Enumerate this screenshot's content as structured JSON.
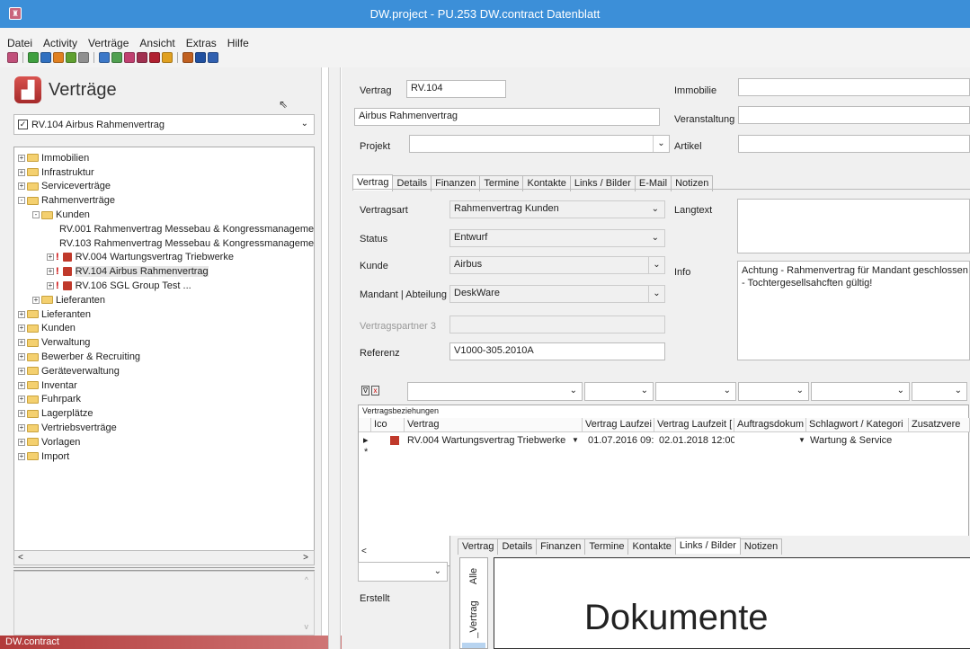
{
  "window": {
    "title": "DW.project - PU.253 DW.contract Datenblatt"
  },
  "menu": [
    "Datei",
    "Activity",
    "Verträge",
    "Ansicht",
    "Extras",
    "Hilfe"
  ],
  "toolbar_colors": [
    "#c0507a",
    "#40a040",
    "#3070c0",
    "#e08020",
    "#60a030",
    "#909090",
    "#3c78c8",
    "#50a050",
    "#c04070",
    "#a03050",
    "#b02030",
    "#e0a020",
    "#c06020",
    "#2050a0",
    "#3060b0"
  ],
  "left": {
    "title": "Verträge",
    "selector": {
      "checked": true,
      "value": "RV.104 Airbus Rahmenvertrag"
    },
    "tree": [
      {
        "label": "Immobilien",
        "level": 0,
        "type": "folder",
        "exp": "+"
      },
      {
        "label": "Infrastruktur",
        "level": 0,
        "type": "folder",
        "exp": "+"
      },
      {
        "label": "Serviceverträge",
        "level": 0,
        "type": "folder",
        "exp": "+"
      },
      {
        "label": "Rahmenverträge",
        "level": 0,
        "type": "folder",
        "exp": "-"
      },
      {
        "label": "Kunden",
        "level": 1,
        "type": "folder",
        "exp": "-"
      },
      {
        "label": "RV.001 Rahmenvertrag Messebau & Kongressmanageme",
        "level": 2,
        "type": "doc"
      },
      {
        "label": "RV.103 Rahmenvertrag Messebau & Kongressmanageme",
        "level": 2,
        "type": "doc"
      },
      {
        "label": "RV.004 Wartungsvertrag Triebwerke",
        "level": 2,
        "type": "doc",
        "exp": "+",
        "bang": true
      },
      {
        "label": "RV.104 Airbus Rahmenvertrag",
        "level": 2,
        "type": "doc",
        "exp": "+",
        "bang": true,
        "selected": true
      },
      {
        "label": "RV.106 SGL Group Test ...",
        "level": 2,
        "type": "doc",
        "exp": "+",
        "bang": true
      },
      {
        "label": "Lieferanten",
        "level": 1,
        "type": "folder",
        "exp": "+"
      },
      {
        "label": "Lieferanten",
        "level": 0,
        "type": "folder",
        "exp": "+"
      },
      {
        "label": "Kunden",
        "level": 0,
        "type": "folder",
        "exp": "+"
      },
      {
        "label": "Verwaltung",
        "level": 0,
        "type": "folder",
        "exp": "+"
      },
      {
        "label": "Bewerber & Recruiting",
        "level": 0,
        "type": "folder",
        "exp": "+"
      },
      {
        "label": "Geräteverwaltung",
        "level": 0,
        "type": "folder",
        "exp": "+"
      },
      {
        "label": "Inventar",
        "level": 0,
        "type": "folder",
        "exp": "+"
      },
      {
        "label": "Fuhrpark",
        "level": 0,
        "type": "folder",
        "exp": "+"
      },
      {
        "label": "Lagerplätze",
        "level": 0,
        "type": "folder",
        "exp": "+"
      },
      {
        "label": "Vertriebsverträge",
        "level": 0,
        "type": "folder",
        "exp": "+"
      },
      {
        "label": "Vorlagen",
        "level": 0,
        "type": "folder",
        "exp": "+"
      },
      {
        "label": "Import",
        "level": 0,
        "type": "folder",
        "exp": "+"
      }
    ],
    "status": "DW.contract"
  },
  "form": {
    "vertrag_label": "Vertrag",
    "vertrag_value": "RV.104",
    "name_value": "Airbus Rahmenvertrag",
    "projekt_label": "Projekt",
    "immobilie_label": "Immobilie",
    "veranstaltung_label": "Veranstaltung",
    "artikel_label": "Artikel",
    "tabs": [
      "Vertrag",
      "Details",
      "Finanzen",
      "Termine",
      "Kontakte",
      "Links / Bilder",
      "E-Mail",
      "Notizen"
    ],
    "vertragsart_label": "Vertragsart",
    "vertragsart_value": "Rahmenvertrag Kunden",
    "status_label": "Status",
    "status_value": "Entwurf",
    "kunde_label": "Kunde",
    "kunde_value": "Airbus",
    "mandant_label": "Mandant | Abteilung",
    "mandant_value": "DeskWare",
    "vp3_label": "Vertragspartner 3",
    "referenz_label": "Referenz",
    "referenz_value": "V1000-305.2010A",
    "langtext_label": "Langtext",
    "info_label": "Info",
    "info_value": "Achtung - Rahmenvertrag für Mandant geschlossen - Tochtergesellsahcften gültig!",
    "erstellt_label": "Erstellt"
  },
  "grid": {
    "caption": "Vertragsbeziehungen",
    "headers": [
      "Ico",
      "Vertrag",
      "Vertrag Laufzei",
      "Vertrag Laufzeit [",
      "Auftragsdokum",
      "Schlagwort / Kategori",
      "Zusatzvere"
    ],
    "row": {
      "vertrag": "RV.004 Wartungsvertrag Triebwerke",
      "start": "01.07.2016 09:",
      "end": "02.01.2018 12:00",
      "schlagwort": "Wartung & Service"
    },
    "new_row_marker": "*",
    "current_row_marker": "▸"
  },
  "overlay": {
    "tabs": [
      "Vertrag",
      "Details",
      "Finanzen",
      "Termine",
      "Kontakte",
      "Links / Bilder",
      "Notizen"
    ],
    "vtabs": [
      "Alle",
      "_Vertrag"
    ],
    "heading": "Dokumente"
  }
}
